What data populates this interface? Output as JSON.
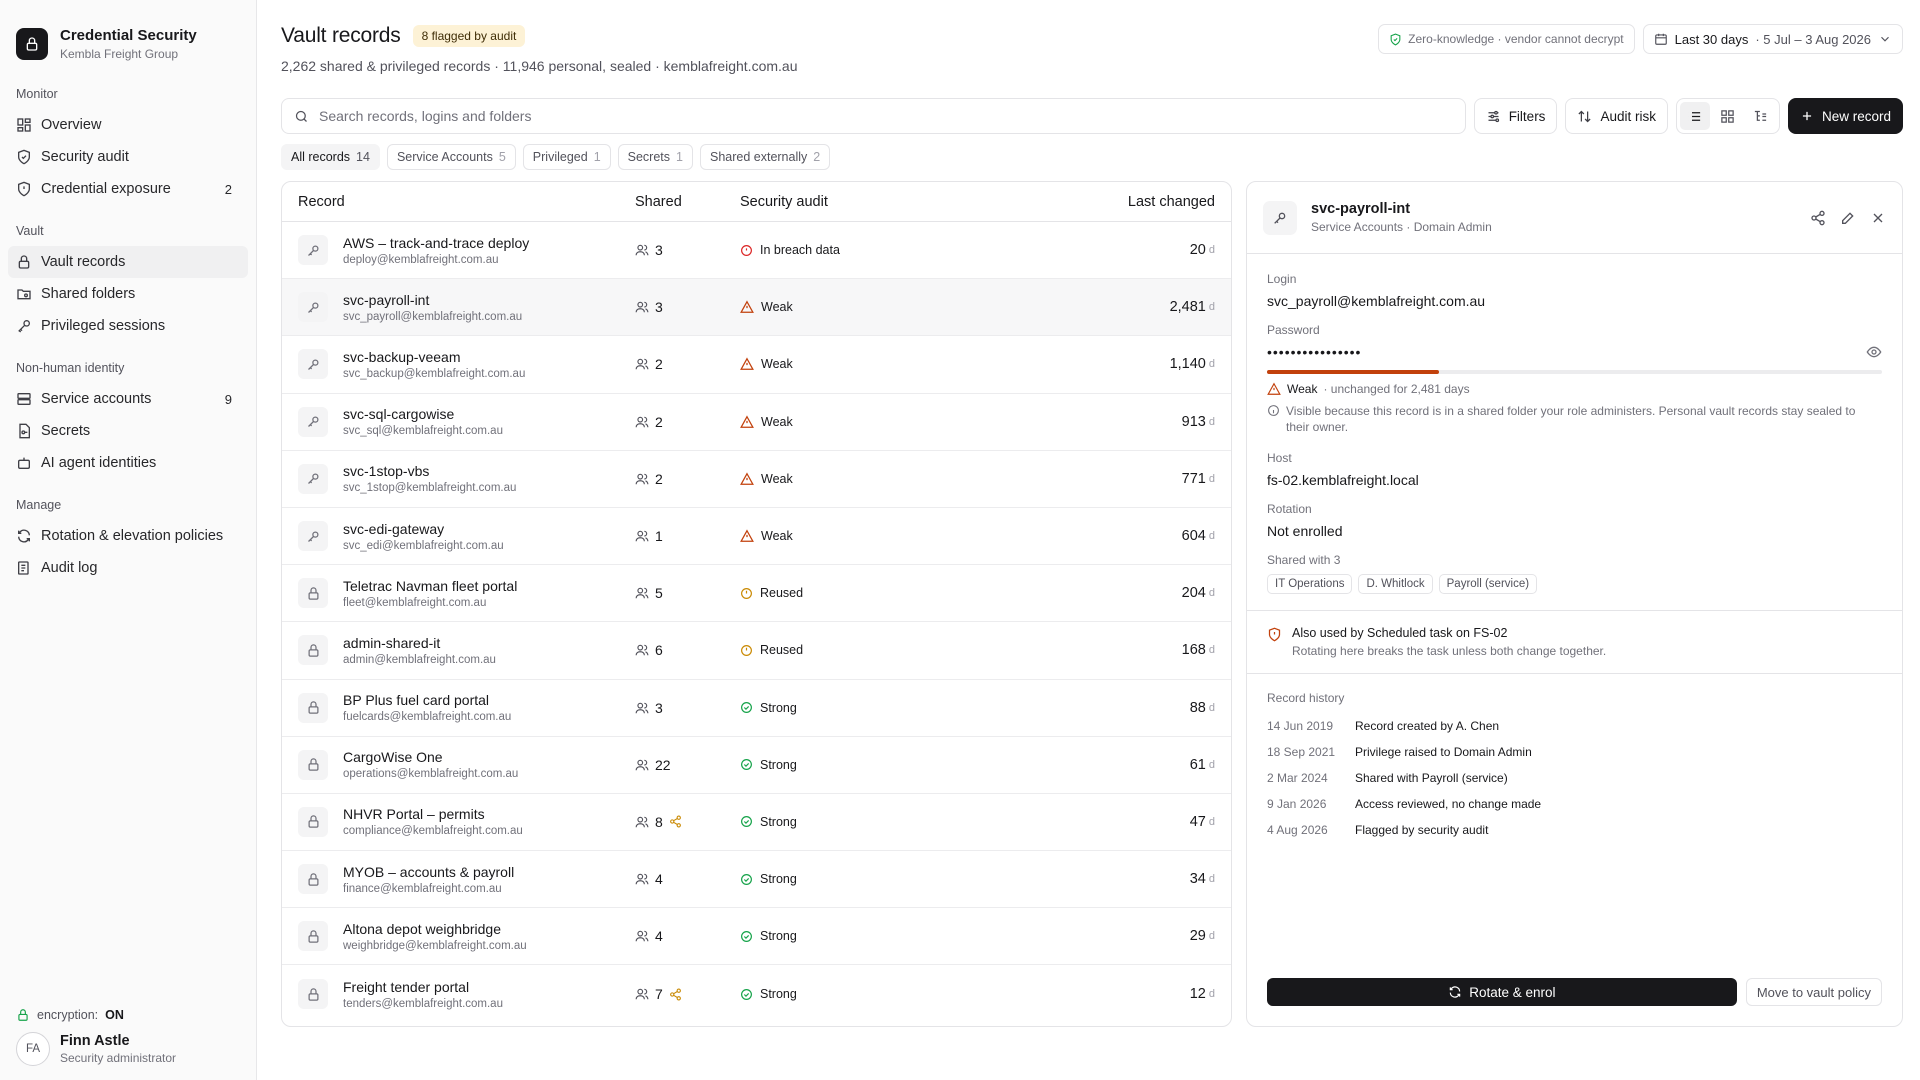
{
  "brand": {
    "title": "Credential Security",
    "subtitle": "Kembla Freight Group"
  },
  "nav": {
    "monitor": {
      "heading": "Monitor",
      "items": [
        {
          "label": "Overview",
          "icon": "grid-icon"
        },
        {
          "label": "Security audit",
          "icon": "shield-icon"
        },
        {
          "label": "Credential exposure",
          "icon": "shield-alert-icon",
          "count": "2"
        }
      ]
    },
    "vault": {
      "heading": "Vault",
      "items": [
        {
          "label": "Vault records",
          "icon": "lock-icon",
          "active": true
        },
        {
          "label": "Shared folders",
          "icon": "folder-share-icon"
        },
        {
          "label": "Privileged sessions",
          "icon": "key-icon"
        }
      ]
    },
    "nhi": {
      "heading": "Non-human identity",
      "items": [
        {
          "label": "Service accounts",
          "icon": "server-icon",
          "count": "9"
        },
        {
          "label": "Secrets",
          "icon": "file-key-icon"
        },
        {
          "label": "AI agent identities",
          "icon": "bot-icon"
        }
      ]
    },
    "manage": {
      "heading": "Manage",
      "items": [
        {
          "label": "Rotation & elevation policies",
          "icon": "refresh-icon"
        },
        {
          "label": "Audit log",
          "icon": "log-icon"
        }
      ]
    }
  },
  "footer": {
    "encryption_label": "encryption:",
    "encryption_value": "ON",
    "user_initials": "FA",
    "user_name": "Finn Astle",
    "user_role": "Security administrator"
  },
  "header": {
    "title": "Vault records",
    "flag_badge": "8 flagged by audit",
    "subtitle": "2,262 shared & privileged records · 11,946 personal, sealed · kemblafreight.com.au",
    "zero_knowledge": "Zero-knowledge · vendor cannot decrypt",
    "range_label": "Last 30 days",
    "range_dates": "· 5 Jul – 3 Aug 2026"
  },
  "toolbar": {
    "search_placeholder": "Search records, logins and folders",
    "filters": "Filters",
    "audit_risk": "Audit risk",
    "new_record": "New record"
  },
  "chips": [
    {
      "label": "All records",
      "count": "14",
      "active": true
    },
    {
      "label": "Service Accounts",
      "count": "5"
    },
    {
      "label": "Privileged",
      "count": "1"
    },
    {
      "label": "Secrets",
      "count": "1"
    },
    {
      "label": "Shared externally",
      "count": "2"
    }
  ],
  "table": {
    "columns": {
      "record": "Record",
      "shared": "Shared",
      "audit": "Security audit",
      "last_changed": "Last changed"
    },
    "day_unit": "d",
    "rows": [
      {
        "name": "AWS – track-and-trace deploy",
        "login": "deploy@kemblafreight.com.au",
        "icon": "key",
        "shared": "3",
        "ext": false,
        "audit": "In breach data",
        "status": "breach",
        "days": "20"
      },
      {
        "name": "svc-payroll-int",
        "login": "svc_payroll@kemblafreight.com.au",
        "icon": "key",
        "shared": "3",
        "ext": false,
        "audit": "Weak",
        "status": "weak",
        "days": "2,481",
        "selected": true
      },
      {
        "name": "svc-backup-veeam",
        "login": "svc_backup@kemblafreight.com.au",
        "icon": "key",
        "shared": "2",
        "ext": false,
        "audit": "Weak",
        "status": "weak",
        "days": "1,140"
      },
      {
        "name": "svc-sql-cargowise",
        "login": "svc_sql@kemblafreight.com.au",
        "icon": "key",
        "shared": "2",
        "ext": false,
        "audit": "Weak",
        "status": "weak",
        "days": "913"
      },
      {
        "name": "svc-1stop-vbs",
        "login": "svc_1stop@kemblafreight.com.au",
        "icon": "key",
        "shared": "2",
        "ext": false,
        "audit": "Weak",
        "status": "weak",
        "days": "771"
      },
      {
        "name": "svc-edi-gateway",
        "login": "svc_edi@kemblafreight.com.au",
        "icon": "key",
        "shared": "1",
        "ext": false,
        "audit": "Weak",
        "status": "weak",
        "days": "604"
      },
      {
        "name": "Teletrac Navman fleet portal",
        "login": "fleet@kemblafreight.com.au",
        "icon": "lock",
        "shared": "5",
        "ext": false,
        "audit": "Reused",
        "status": "reused",
        "days": "204"
      },
      {
        "name": "admin-shared-it",
        "login": "admin@kemblafreight.com.au",
        "icon": "lock",
        "shared": "6",
        "ext": false,
        "audit": "Reused",
        "status": "reused",
        "days": "168"
      },
      {
        "name": "BP Plus fuel card portal",
        "login": "fuelcards@kemblafreight.com.au",
        "icon": "lock",
        "shared": "3",
        "ext": false,
        "audit": "Strong",
        "status": "strong",
        "days": "88"
      },
      {
        "name": "CargoWise One",
        "login": "operations@kemblafreight.com.au",
        "icon": "lock",
        "shared": "22",
        "ext": false,
        "audit": "Strong",
        "status": "strong",
        "days": "61"
      },
      {
        "name": "NHVR Portal – permits",
        "login": "compliance@kemblafreight.com.au",
        "icon": "lock",
        "shared": "8",
        "ext": true,
        "audit": "Strong",
        "status": "strong",
        "days": "47"
      },
      {
        "name": "MYOB – accounts & payroll",
        "login": "finance@kemblafreight.com.au",
        "icon": "lock",
        "shared": "4",
        "ext": false,
        "audit": "Strong",
        "status": "strong",
        "days": "34"
      },
      {
        "name": "Altona depot weighbridge",
        "login": "weighbridge@kemblafreight.com.au",
        "icon": "lock",
        "shared": "4",
        "ext": false,
        "audit": "Strong",
        "status": "strong",
        "days": "29"
      },
      {
        "name": "Freight tender portal",
        "login": "tenders@kemblafreight.com.au",
        "icon": "lock",
        "shared": "7",
        "ext": true,
        "audit": "Strong",
        "status": "strong",
        "days": "12"
      }
    ]
  },
  "detail": {
    "title": "svc-payroll-int",
    "subtitle": "Service Accounts · Domain Admin",
    "login_label": "Login",
    "login_value": "svc_payroll@kemblafreight.com.au",
    "password_label": "Password",
    "password_value": "••••••••••••••••",
    "strength_fraction": 0.28,
    "strength_word": "Weak",
    "strength_note": "· unchanged for 2,481 days",
    "visibility_note": "Visible because this record is in a shared folder your role administers. Personal vault records stay sealed to their owner.",
    "host_label": "Host",
    "host_value": "fs-02.kemblafreight.local",
    "rotation_label": "Rotation",
    "rotation_value": "Not enrolled",
    "shared_label": "Shared with 3",
    "shared_with": [
      "IT Operations",
      "D. Whitlock",
      "Payroll (service)"
    ],
    "also_used_title": "Also used by Scheduled task on FS-02",
    "also_used_desc": "Rotating here breaks the task unless both change together.",
    "history_title": "Record history",
    "history": [
      {
        "date": "14 Jun 2019",
        "event": "Record created by A. Chen"
      },
      {
        "date": "18 Sep 2021",
        "event": "Privilege raised to Domain Admin"
      },
      {
        "date": "2 Mar 2024",
        "event": "Shared with Payroll (service)"
      },
      {
        "date": "9 Jan 2026",
        "event": "Access reviewed, no change made"
      },
      {
        "date": "4 Aug 2026",
        "event": "Flagged by security audit"
      }
    ],
    "rotate_button": "Rotate & enrol",
    "move_button": "Move to vault policy"
  },
  "colors": {
    "breach": "#dc2626",
    "weak": "#c2410c",
    "reused": "#ca8a04",
    "strong": "#16a34a",
    "external": "#ca8a04"
  }
}
